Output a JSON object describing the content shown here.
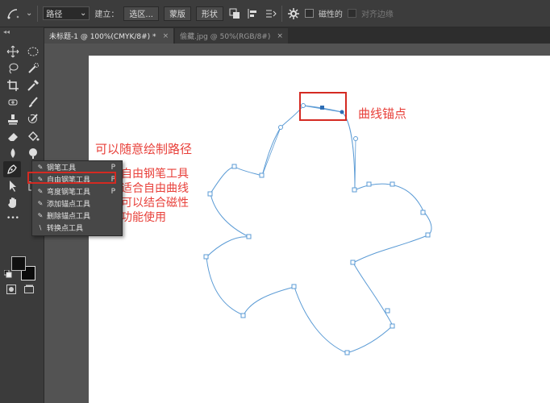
{
  "options_bar": {
    "mode_value": "路径",
    "build_label": "建立：",
    "selection_button": "选区...",
    "mask_button": "蒙版",
    "shape_button": "形状",
    "magnetic_label": "磁性的",
    "align_edges_label": "对齐边缘"
  },
  "tabs": [
    {
      "label": "未标题-1 @ 100%(CMYK/8#) *",
      "close": "×"
    },
    {
      "label": "偷藏.jpg @ 50%(RGB/8#)",
      "close": "×"
    }
  ],
  "toolbar": {
    "collapse": "◂◂",
    "more_tools": "•••"
  },
  "flyout": {
    "items": [
      {
        "label": "钢笔工具",
        "key": "P"
      },
      {
        "label": "自由钢笔工具",
        "key": "P"
      },
      {
        "label": "弯度钢笔工具",
        "key": "P"
      },
      {
        "label": "添加锚点工具",
        "key": ""
      },
      {
        "label": "删除锚点工具",
        "key": ""
      },
      {
        "label": "转换点工具",
        "key": ""
      }
    ]
  },
  "annotations": {
    "anchor_label": "曲线锚点",
    "freeform_label": "可以随意绘制路径",
    "desc_lines": [
      "自由钢笔工具",
      "适合自由曲线",
      "可以结合磁性",
      "功能使用"
    ]
  },
  "colors": {
    "annotation_red": "#e8403a",
    "path_blue": "#5b9bd5",
    "anchor_fill": "#2f6eb5"
  }
}
